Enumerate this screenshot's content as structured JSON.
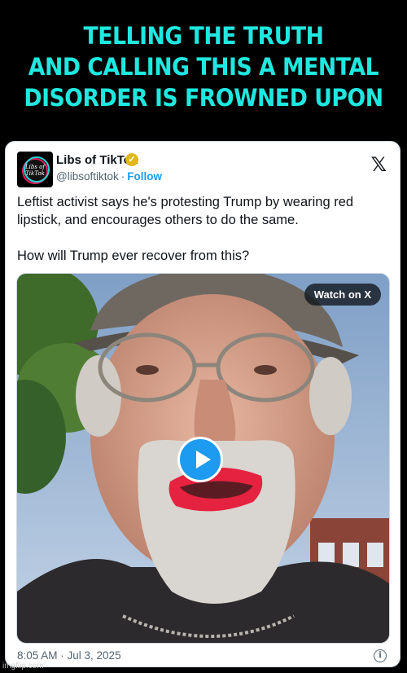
{
  "headline": {
    "line1": "TELLING THE TRUTH",
    "line2": "AND CALLING THIS A MENTAL",
    "line3": "DISORDER IS FROWNED UPON"
  },
  "post": {
    "avatar_text": "Libs of TikTok",
    "author_name": "Libs of TikTok",
    "verified_icon": "verified-badge-icon",
    "handle": "@libsoftiktok",
    "separator": "·",
    "follow_label": "Follow",
    "platform_icon": "x-logo-icon",
    "platform_glyph": "𝕏",
    "text_paragraph_1": "Leftist activist says he's protesting Trump by wearing red lipstick, and encourages others to do the same.",
    "text_paragraph_2": "How will Trump ever recover from this?",
    "media": {
      "watch_label": "Watch on X",
      "play_icon": "play-icon"
    },
    "timestamp": "8:05 AM · Jul 3, 2025",
    "info_icon": "info-icon",
    "info_glyph": "i"
  },
  "watermark": "imgflip.com",
  "colors": {
    "headline": "#1fe8e0",
    "link": "#1d9bf0",
    "muted": "#536471",
    "lipstick": "#e5223f"
  }
}
